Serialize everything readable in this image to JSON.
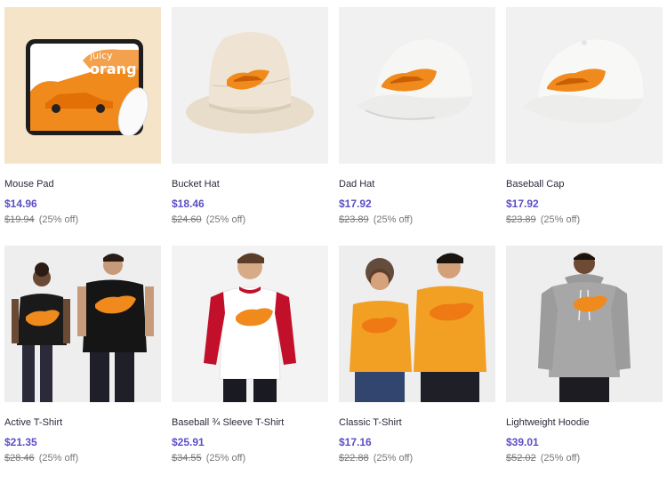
{
  "products": [
    {
      "title": "Mouse Pad",
      "price": "$14.96",
      "original_price": "$19.94",
      "discount": "(25% off)",
      "image": "mouse-pad-image",
      "thumb_text": [
        "juicy",
        "orang"
      ]
    },
    {
      "title": "Bucket Hat",
      "price": "$18.46",
      "original_price": "$24.60",
      "discount": "(25% off)",
      "image": "bucket-hat-image"
    },
    {
      "title": "Dad Hat",
      "price": "$17.92",
      "original_price": "$23.89",
      "discount": "(25% off)",
      "image": "dad-hat-image"
    },
    {
      "title": "Baseball Cap",
      "price": "$17.92",
      "original_price": "$23.89",
      "discount": "(25% off)",
      "image": "baseball-cap-image"
    },
    {
      "title": "Active T-Shirt",
      "price": "$21.35",
      "original_price": "$28.46",
      "discount": "(25% off)",
      "image": "active-tshirt-image"
    },
    {
      "title": "Baseball ¾ Sleeve T-Shirt",
      "price": "$25.91",
      "original_price": "$34.55",
      "discount": "(25% off)",
      "image": "baseball-sleeve-tshirt-image"
    },
    {
      "title": "Classic T-Shirt",
      "price": "$17.16",
      "original_price": "$22.88",
      "discount": "(25% off)",
      "image": "classic-tshirt-image"
    },
    {
      "title": "Lightweight Hoodie",
      "price": "$39.01",
      "original_price": "$52.02",
      "discount": "(25% off)",
      "image": "lightweight-hoodie-image"
    }
  ],
  "colors": {
    "accent_price": "#5b4ec7",
    "design_orange": "#f08a1c"
  }
}
